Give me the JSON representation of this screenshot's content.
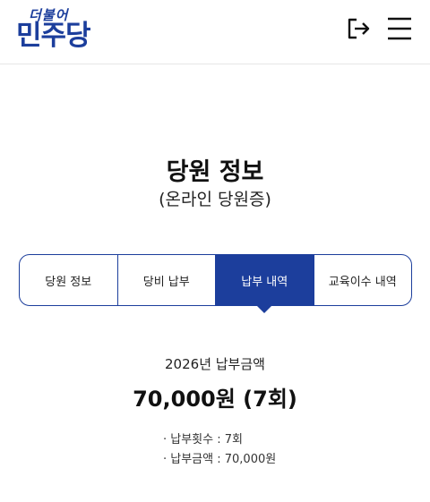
{
  "header": {
    "logo_script": "더불어",
    "logo_main": "민주당",
    "brand_color": "#1c3e9c",
    "logout_icon": "logout-icon",
    "menu_icon": "hamburger-menu-icon"
  },
  "page": {
    "title": "당원 정보",
    "subtitle": "(온라인 당원증)"
  },
  "tabs": [
    {
      "label": "당원 정보",
      "active": false
    },
    {
      "label": "당비 납부",
      "active": false
    },
    {
      "label": "납부 내역",
      "active": true
    },
    {
      "label": "교육이수 내역",
      "active": false
    }
  ],
  "summary": {
    "year_label": "2026년 납부금액",
    "amount": "70,000원 (7회)",
    "details": [
      "· 납부횟수 : 7회",
      "· 납부금액 : 70,000원"
    ]
  }
}
